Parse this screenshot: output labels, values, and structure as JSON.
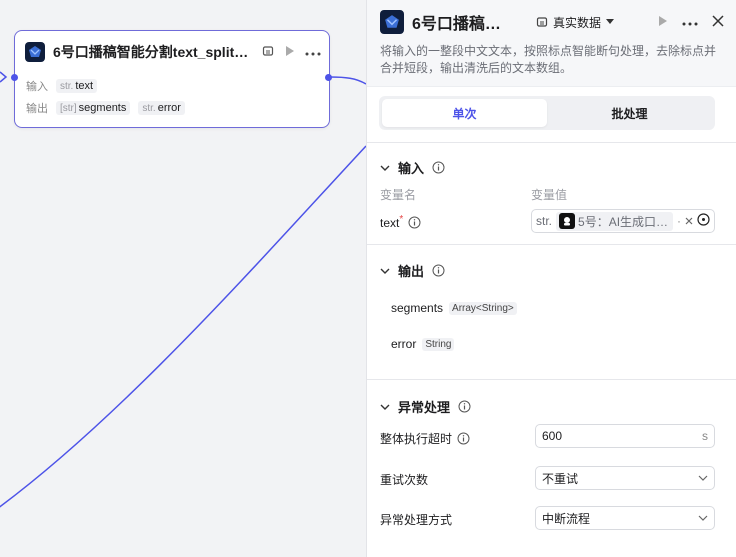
{
  "node": {
    "title": "6号口播稿智能分割text_split…",
    "input_label": "输入",
    "output_label": "输出",
    "inputs": [
      {
        "type": "str.",
        "name": "text"
      }
    ],
    "outputs": [
      {
        "type": "[str]",
        "name": "segments"
      },
      {
        "type": "str.",
        "name": "error"
      }
    ]
  },
  "panel": {
    "title": "6号口播稿…",
    "data_select": "真实数据",
    "description": "将输入的一整段中文文本，按照标点智能断句处理，去除标点并合并短段，输出清洗后的文本数组。",
    "tabs": [
      "单次",
      "批处理"
    ],
    "active_tab": "单次",
    "input_section": {
      "title": "输入",
      "col_name": "变量名",
      "col_value": "变量值",
      "var_name": "text",
      "required_mark": "*",
      "var_type": "str.",
      "var_value": "5号：AI生成口…",
      "var_sep": "·"
    },
    "output_section": {
      "title": "输出",
      "items": [
        {
          "name": "segments",
          "type": "Array<String>"
        },
        {
          "name": "error",
          "type": "String"
        }
      ]
    },
    "exception_section": {
      "title": "异常处理",
      "timeout_label": "整体执行超时",
      "timeout_value": "600",
      "timeout_unit": "s",
      "retry_label": "重试次数",
      "retry_value": "不重试",
      "handling_label": "异常处理方式",
      "handling_value": "中断流程"
    }
  },
  "colors": {
    "accent": "#4d53e8",
    "node_border": "#6f6bd9",
    "edge": "#4d53e8",
    "canvas_bg": "#f2f3f5"
  },
  "icons": [
    "app-icon",
    "debug-icon",
    "play-icon",
    "more-icon",
    "close-icon",
    "chevron-down-icon",
    "info-icon",
    "close-small-icon",
    "target-icon"
  ]
}
